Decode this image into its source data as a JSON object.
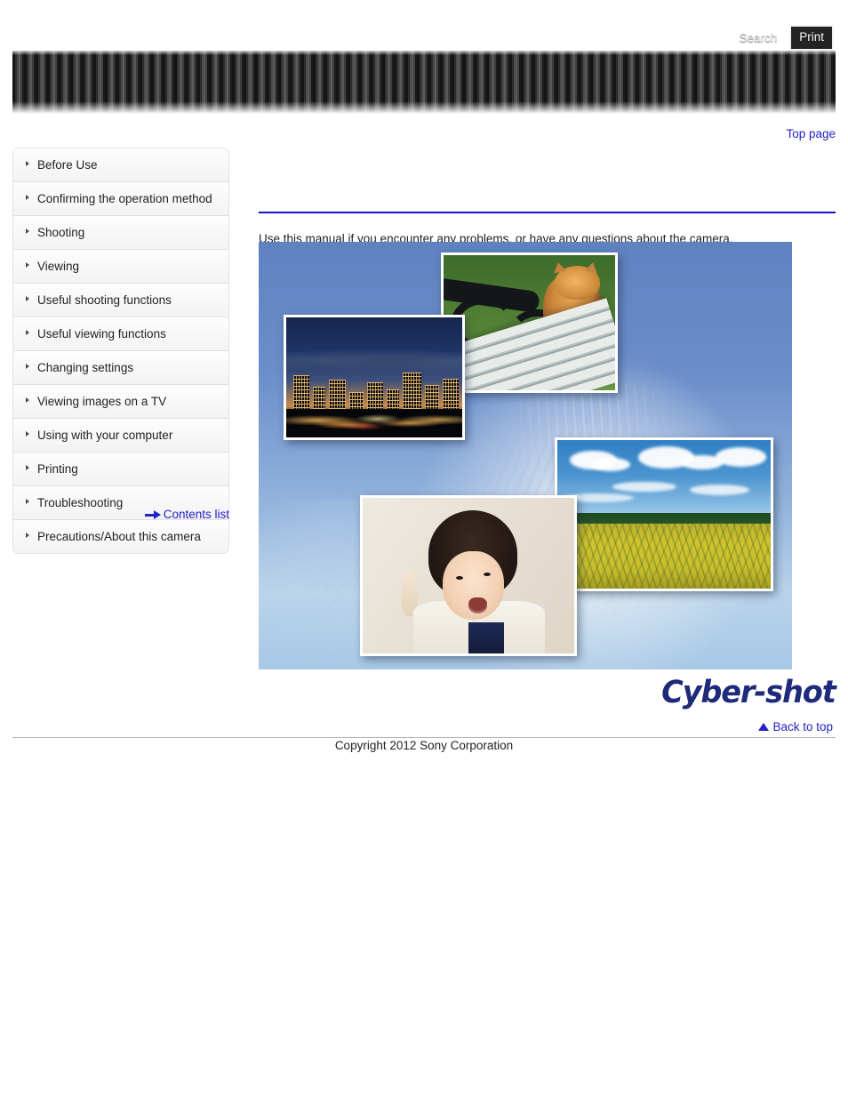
{
  "header": {
    "search_label": "Search",
    "print_label": "Print",
    "search_icon": "search-icon",
    "print_icon": "printer-icon"
  },
  "toppage": {
    "label": "Top page"
  },
  "sidebar": {
    "items": [
      {
        "label": "Before Use"
      },
      {
        "label": "Confirming the operation method"
      },
      {
        "label": "Shooting"
      },
      {
        "label": "Viewing"
      },
      {
        "label": "Useful shooting functions"
      },
      {
        "label": "Useful viewing functions"
      },
      {
        "label": "Changing settings"
      },
      {
        "label": "Viewing images on a TV"
      },
      {
        "label": "Using with your computer"
      },
      {
        "label": "Printing"
      },
      {
        "label": "Troubleshooting"
      },
      {
        "label": "Precautions/About this camera"
      }
    ],
    "contents_list_label": "Contents list",
    "contents_list_icon": "arrow-right-icon"
  },
  "main": {
    "lead_text": "Use this manual if you encounter any problems, or have any questions about the camera.",
    "hero_alt": "Cyber-shot sample photographs collage",
    "hero_photos": [
      {
        "name": "night-cityscape-photo"
      },
      {
        "name": "cat-on-bench-photo"
      },
      {
        "name": "sunflower-field-photo"
      },
      {
        "name": "child-portrait-photo"
      }
    ]
  },
  "branding": {
    "logo_text": "Cyber-shot"
  },
  "footer": {
    "back_to_top_label": "Back to top",
    "back_to_top_icon": "triangle-up-icon",
    "copyright": "Copyright 2012 Sony Corporation"
  },
  "colors": {
    "link_blue": "#2222c8",
    "rule_blue": "#1414c8",
    "logo_navy": "#1e2a7a",
    "header_dark": "#3a3a3a"
  }
}
